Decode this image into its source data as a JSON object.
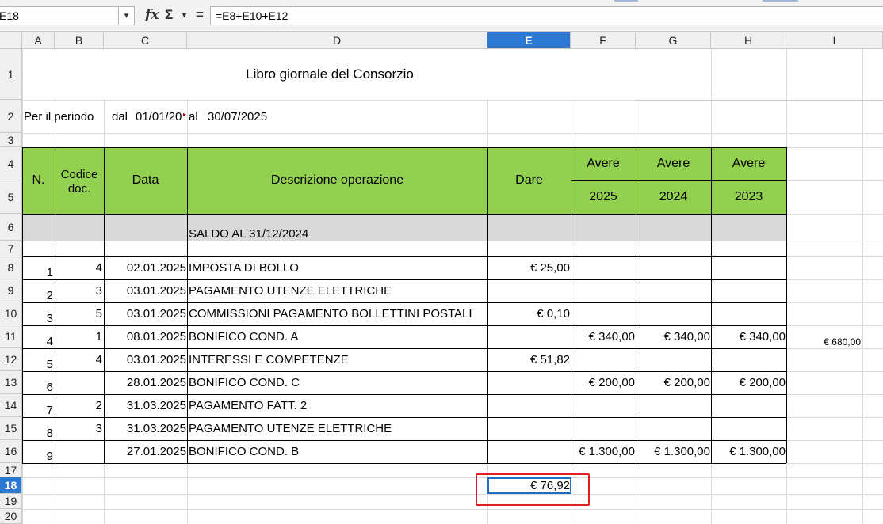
{
  "formula_bar": {
    "name_box": "E18",
    "formula": "=E8+E10+E12",
    "fx_icon": "fx",
    "sum_icon": "Σ",
    "equals_icon": "="
  },
  "columns": [
    "A",
    "B",
    "C",
    "D",
    "E",
    "F",
    "G",
    "H",
    "I"
  ],
  "rows": [
    "1",
    "2",
    "3",
    "4",
    "5",
    "6",
    "7",
    "8",
    "9",
    "10",
    "11",
    "12",
    "13",
    "14",
    "15",
    "16",
    "17",
    "18",
    "19",
    "20"
  ],
  "sheet": {
    "title": "Libro giornale del Consorzio",
    "period_label": "Per il periodo",
    "dal": "dal",
    "from_date": "01/01/20",
    "al": "al",
    "to_date": "30/07/2025",
    "header": {
      "n": "N.",
      "codice_line1": "Codice",
      "codice_line2": "doc.",
      "data": "Data",
      "descrizione": "Descrizione operazione",
      "dare": "Dare",
      "avere": "Avere",
      "years": [
        "2025",
        "2024",
        "2023"
      ]
    },
    "saldo": "SALDO AL 31/12/2024",
    "entries": [
      {
        "n": "1",
        "cod": "4",
        "data": "02.01.2025",
        "desc": "IMPOSTA DI BOLLO",
        "dare": "€ 25,00",
        "f": "",
        "g": "",
        "h": "",
        "i": ""
      },
      {
        "n": "2",
        "cod": "3",
        "data": "03.01.2025",
        "desc": "PAGAMENTO UTENZE ELETTRICHE",
        "dare": "",
        "f": "",
        "g": "",
        "h": "",
        "i": ""
      },
      {
        "n": "3",
        "cod": "5",
        "data": "03.01.2025",
        "desc": "COMMISSIONI PAGAMENTO BOLLETTINI POSTALI",
        "dare": "€ 0,10",
        "f": "",
        "g": "",
        "h": "",
        "i": ""
      },
      {
        "n": "4",
        "cod": "1",
        "data": "08.01.2025",
        "desc": "BONIFICO COND. A",
        "dare": "",
        "f": "€ 340,00",
        "g": "€ 340,00",
        "h": "€ 340,00",
        "i": "€ 680,00"
      },
      {
        "n": "5",
        "cod": "4",
        "data": "03.01.2025",
        "desc": "INTERESSI E COMPETENZE",
        "dare": "€ 51,82",
        "f": "",
        "g": "",
        "h": "",
        "i": ""
      },
      {
        "n": "6",
        "cod": "",
        "data": "28.01.2025",
        "desc": "BONIFICO COND. C",
        "dare": "",
        "f": "€ 200,00",
        "g": "€ 200,00",
        "h": "€ 200,00",
        "i": ""
      },
      {
        "n": "7",
        "cod": "2",
        "data": "31.03.2025",
        "desc": "PAGAMENTO FATT. 2",
        "dare": "",
        "f": "",
        "g": "",
        "h": "",
        "i": ""
      },
      {
        "n": "8",
        "cod": "3",
        "data": "31.03.2025",
        "desc": "PAGAMENTO UTENZE ELETTRICHE",
        "dare": "",
        "f": "",
        "g": "",
        "h": "",
        "i": ""
      },
      {
        "n": "9",
        "cod": "",
        "data": "27.01.2025",
        "desc": "BONIFICO COND. B",
        "dare": "",
        "f": "€ 1.300,00",
        "g": "€ 1.300,00",
        "h": "€ 1.300,00",
        "i": ""
      }
    ],
    "total_dare": "€ 76,92"
  },
  "colors": {
    "header_green": "#92d050",
    "saldo_gray": "#d9d9d9",
    "selection_blue": "#2b79d3",
    "highlight_red": "#e02020"
  }
}
